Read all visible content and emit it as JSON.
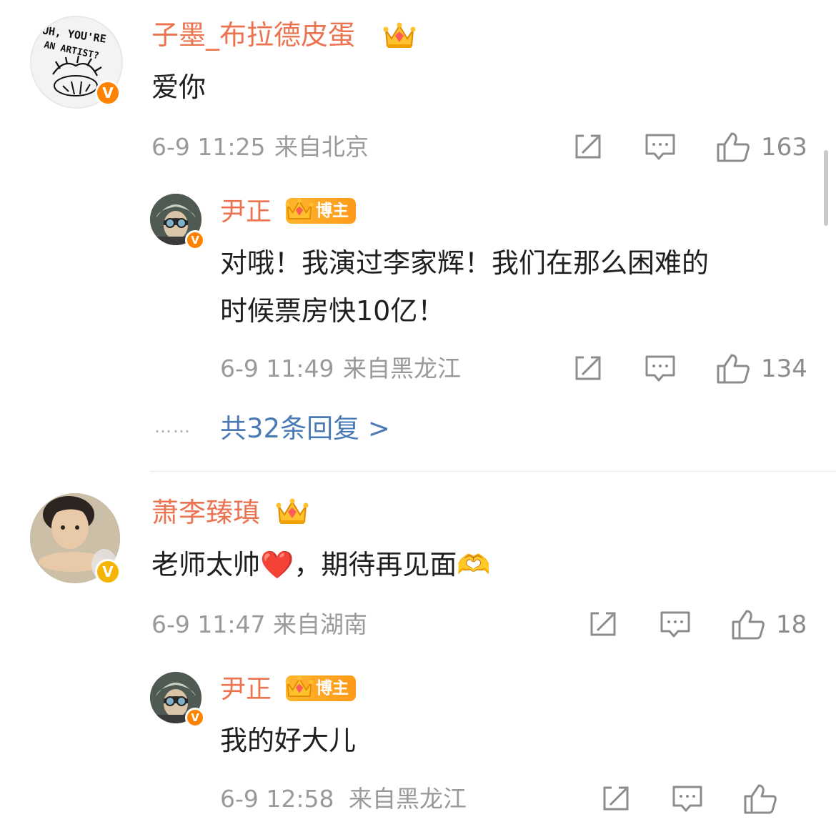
{
  "comments": [
    {
      "username": "子墨_布拉德皮蛋",
      "avatar_text": "UH, YOU'RE AN ARTIST?",
      "badge": "V",
      "text": "爱你",
      "time": "6-9 11:25",
      "location": "来自北京",
      "likes": "163",
      "reply": {
        "username": "尹正",
        "tag": "博主",
        "badge": "V",
        "text_line1": "对哦！我演过李家辉！我们在那么困难的",
        "text_line2": "时候票房快10亿！",
        "time": "6-9 11:49",
        "location": "来自黑龙江",
        "likes": "134"
      },
      "more_replies": "共32条回复 >",
      "dots": "……"
    },
    {
      "username": "萧李臻瑱",
      "badge": "V",
      "text": "老师太帅❤️，期待再见面🫶",
      "time": "6-9 11:47",
      "location": "来自湖南",
      "likes": "18",
      "reply": {
        "username": "尹正",
        "tag": "博主",
        "badge": "V",
        "text": "我的好大儿",
        "time": "6-9 12:58",
        "location": "来自黑龙江"
      }
    }
  ],
  "icons": [
    "share-icon",
    "comment-icon",
    "like-icon",
    "crown-icon"
  ],
  "colors": {
    "username": "#eb7350",
    "link": "#4a7ab5",
    "meta": "#9a9a9a",
    "badge_orange": "#ff8200",
    "badge_gold": "#f4b400"
  }
}
